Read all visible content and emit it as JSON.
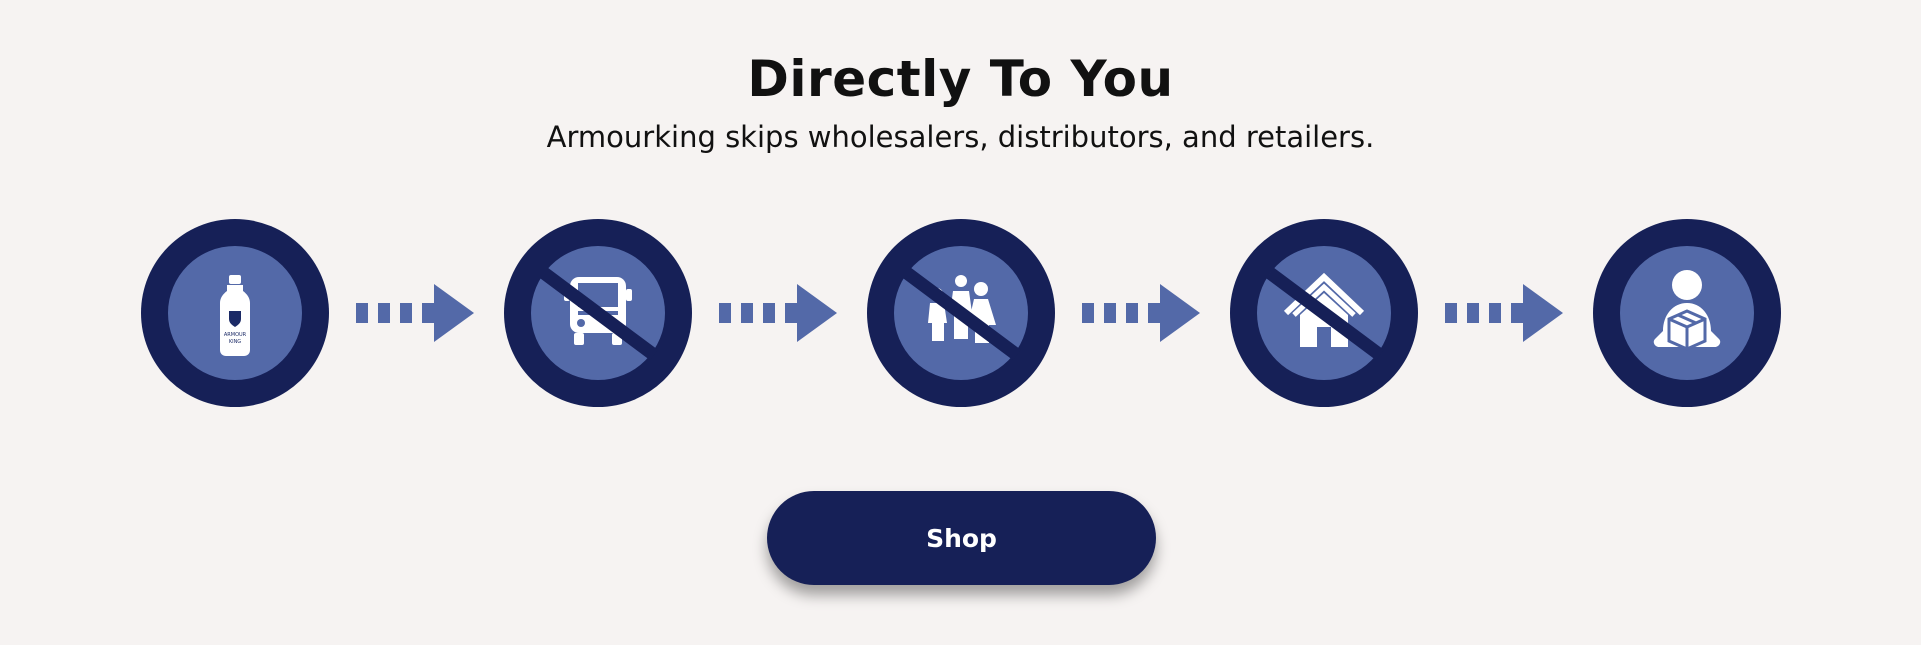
{
  "heading": "Directly To You",
  "subheading": "Armourking skips wholesalers, distributors, and retailers.",
  "bottle_brand_line1": "ARMOUR",
  "bottle_brand_line2": "KING",
  "steps": [
    {
      "icon": "water-bottle-icon",
      "crossed": false
    },
    {
      "icon": "delivery-truck-icon",
      "crossed": true
    },
    {
      "icon": "people-group-icon",
      "crossed": true
    },
    {
      "icon": "house-store-icon",
      "crossed": true
    },
    {
      "icon": "person-with-package-icon",
      "crossed": false
    }
  ],
  "shop_label": "Shop",
  "colors": {
    "background": "#f6f3f2",
    "navy": "#162057",
    "blue": "#5369a8"
  }
}
